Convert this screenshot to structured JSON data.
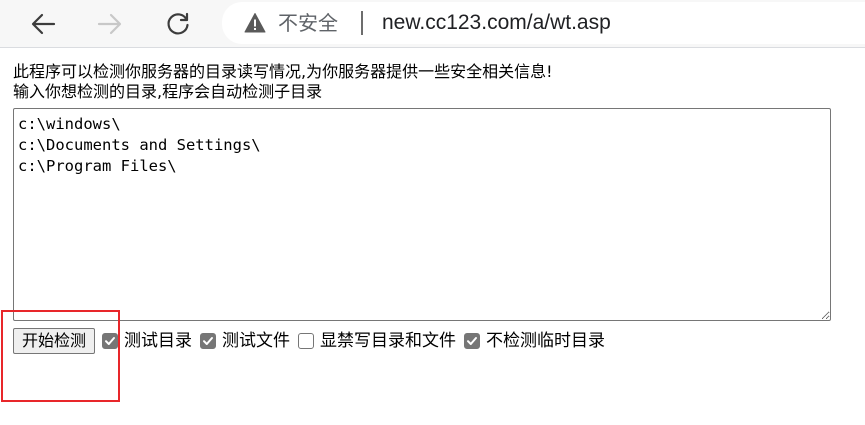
{
  "browser": {
    "security_label": "不安全",
    "url": "new.cc123.com/a/wt.asp"
  },
  "page": {
    "intro_line1": "此程序可以检测你服务器的目录读写情况,为你服务器提供一些安全相关信息!",
    "intro_line2": "输入你想检测的目录,程序会自动检测子目录",
    "directories": "c:\\windows\\\nc:\\Documents and Settings\\\nc:\\Program Files\\",
    "start_button_label": "开始检测",
    "options": [
      {
        "label": "测试目录",
        "checked": true
      },
      {
        "label": "测试文件",
        "checked": true
      },
      {
        "label": "显禁写目录和文件",
        "checked": false
      },
      {
        "label": "不检测临时目录",
        "checked": true
      }
    ]
  },
  "colors": {
    "highlight": "#e8262a",
    "checkbox_checked": "#767676"
  },
  "icons": {
    "back": "arrow-left",
    "forward": "arrow-right",
    "reload": "reload",
    "security": "warning-triangle"
  }
}
